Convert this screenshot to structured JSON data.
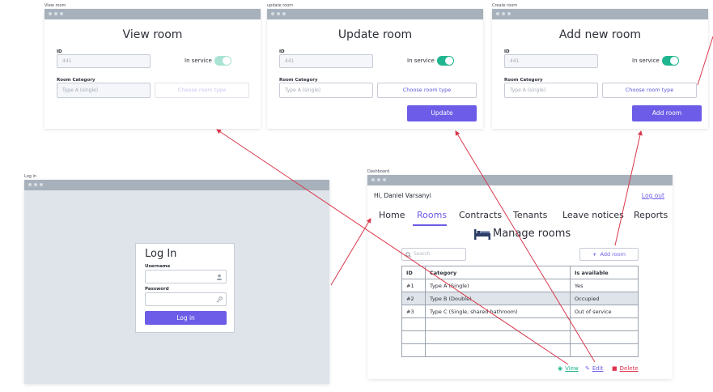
{
  "view_room": {
    "caption": "View room",
    "title": "View room",
    "id_label": "ID",
    "id_value": "441",
    "in_service_label": "In service",
    "category_label": "Room Category",
    "category_value": "Type A (single)",
    "choose_label": "Choose room type"
  },
  "update_room": {
    "caption": "update room",
    "title": "Update room",
    "id_label": "ID",
    "id_value": "441",
    "in_service_label": "In service",
    "category_label": "Room Category",
    "category_value": "Type A (single)",
    "choose_label": "Choose room type",
    "submit_label": "Update"
  },
  "add_room": {
    "caption": "Create room",
    "title": "Add new room",
    "id_label": "ID",
    "id_value": "441",
    "in_service_label": "In service",
    "category_label": "Room Category",
    "category_value": "Type A (single)",
    "choose_label": "Choose room type",
    "submit_label": "Add room"
  },
  "login": {
    "caption": "Log in",
    "title": "Log In",
    "username_label": "Username",
    "password_label": "Password",
    "submit_label": "Log in"
  },
  "dashboard": {
    "caption": "Dashboard",
    "greeting": "Hi, Daniel Varsanyi",
    "logout": "Log out",
    "nav": [
      "Home",
      "Rooms",
      "Contracts",
      "Tenants",
      "Leave notices",
      "Reports"
    ],
    "page_title": "Manage rooms",
    "search_placeholder": "Search",
    "add_room_label": "Add room",
    "table_headers": [
      "ID",
      "Category",
      "Is available"
    ],
    "rows": [
      [
        "#1",
        "Type A (Single)",
        "Yes"
      ],
      [
        "#2",
        "Type B (Double)",
        "Occupied"
      ],
      [
        "#3",
        "Type C (Single, shared bathroom)",
        "Out of service"
      ]
    ],
    "actions": {
      "view": "View",
      "edit": "Edit",
      "delete": "Delete"
    }
  },
  "colors": {
    "accent": "#6c5ce7",
    "toggle_on": "#1fb58f",
    "view": "#1fb58f",
    "delete": "#e0344e",
    "arrow": "#d9374b",
    "titlebar": "#a7b1bc"
  },
  "icons": [
    "user-icon",
    "key-icon",
    "search-icon",
    "plus-icon",
    "bed-icon",
    "eye-icon",
    "pencil-icon",
    "trash-icon"
  ]
}
